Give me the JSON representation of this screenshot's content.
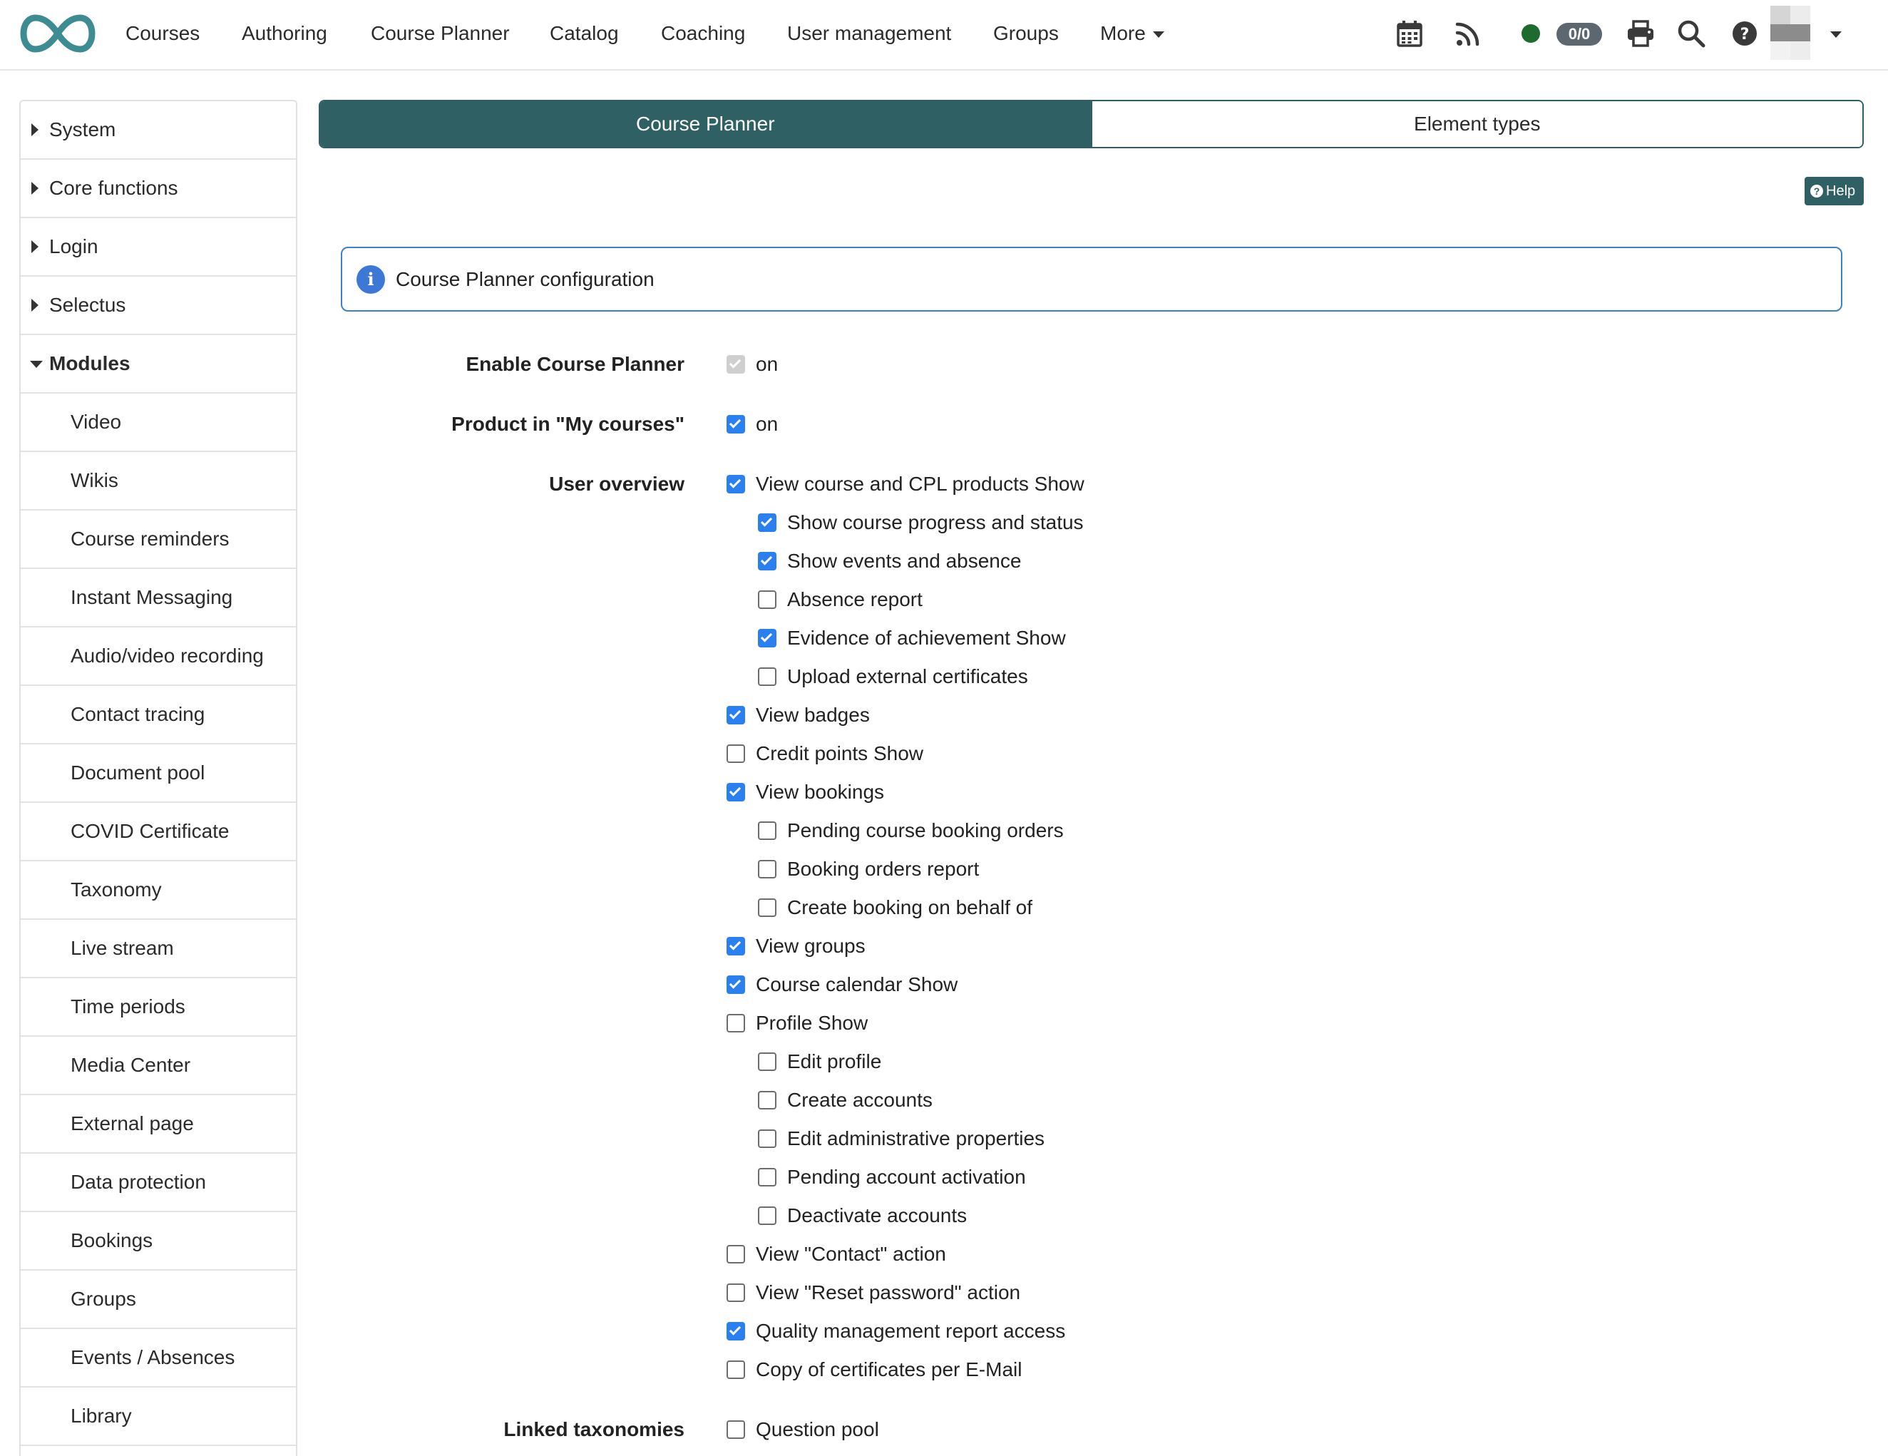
{
  "nav": {
    "items": [
      "Courses",
      "Authoring",
      "Course Planner",
      "Catalog",
      "Coaching",
      "User management",
      "Groups"
    ],
    "more_label": "More",
    "counter": "0/0",
    "icons": [
      "calendar-icon",
      "rss-icon",
      "online-status-icon",
      "print-icon",
      "search-icon",
      "help-icon",
      "avatar"
    ],
    "brand_color": "#3d8c91"
  },
  "sidebar": {
    "top_items": [
      "System",
      "Core functions",
      "Login",
      "Selectus"
    ],
    "active_item": "Modules",
    "module_items": [
      "Video",
      "Wikis",
      "Course reminders",
      "Instant Messaging",
      "Audio/video recording",
      "Contact tracing",
      "Document pool",
      "COVID Certificate",
      "Taxonomy",
      "Live stream",
      "Time periods",
      "Media Center",
      "External page",
      "Data protection",
      "Bookings",
      "Groups",
      "Events / Absences",
      "Library"
    ]
  },
  "tabs": {
    "active": "Course Planner",
    "inactive": "Element types",
    "active_color": "#2f6164"
  },
  "help_label": "Help",
  "info": {
    "text": "Course Planner configuration"
  },
  "form": {
    "enable_label": "Enable Course Planner",
    "enable_option": {
      "label": "on",
      "checked": true,
      "disabled": true
    },
    "product_label": "Product in \"My courses\"",
    "product_option": {
      "label": "on",
      "checked": true
    },
    "overview_label": "User overview",
    "overview_options": [
      {
        "label": "View course and CPL products Show",
        "checked": true,
        "indent": 0
      },
      {
        "label": "Show course progress and status",
        "checked": true,
        "indent": 1
      },
      {
        "label": "Show events and absence",
        "checked": true,
        "indent": 1
      },
      {
        "label": "Absence report",
        "checked": false,
        "indent": 1
      },
      {
        "label": "Evidence of achievement Show",
        "checked": true,
        "indent": 1
      },
      {
        "label": "Upload external certificates",
        "checked": false,
        "indent": 1
      },
      {
        "label": "View badges",
        "checked": true,
        "indent": 0
      },
      {
        "label": "Credit points Show",
        "checked": false,
        "indent": 0
      },
      {
        "label": "View bookings",
        "checked": true,
        "indent": 0
      },
      {
        "label": "Pending course booking orders",
        "checked": false,
        "indent": 1
      },
      {
        "label": "Booking orders report",
        "checked": false,
        "indent": 1
      },
      {
        "label": "Create booking on behalf of",
        "checked": false,
        "indent": 1
      },
      {
        "label": "View groups",
        "checked": true,
        "indent": 0
      },
      {
        "label": "Course calendar Show",
        "checked": true,
        "indent": 0
      },
      {
        "label": "Profile Show",
        "checked": false,
        "indent": 0
      },
      {
        "label": "Edit profile",
        "checked": false,
        "indent": 1
      },
      {
        "label": "Create accounts",
        "checked": false,
        "indent": 1
      },
      {
        "label": "Edit administrative properties",
        "checked": false,
        "indent": 1
      },
      {
        "label": "Pending account activation",
        "checked": false,
        "indent": 1
      },
      {
        "label": "Deactivate accounts",
        "checked": false,
        "indent": 1
      },
      {
        "label": "View \"Contact\" action",
        "checked": false,
        "indent": 0
      },
      {
        "label": "View \"Reset password\" action",
        "checked": false,
        "indent": 0
      },
      {
        "label": "Quality management report access",
        "checked": true,
        "indent": 0
      },
      {
        "label": "Copy of certificates per E-Mail",
        "checked": false,
        "indent": 0
      }
    ],
    "taxonomy_label": "Linked taxonomies",
    "taxonomy_options": [
      {
        "label": "Question pool",
        "checked": false,
        "indent": 0
      }
    ]
  }
}
